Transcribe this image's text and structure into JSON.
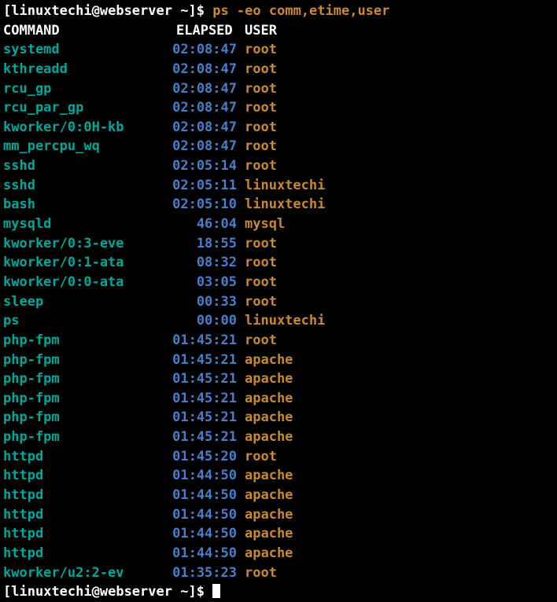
{
  "prompt": {
    "user": "linuxtechi",
    "host": "webserver",
    "path": "~",
    "command": "ps -eo comm,etime,user"
  },
  "headers": {
    "command": "COMMAND",
    "elapsed": "ELAPSED",
    "user": "USER"
  },
  "rows": [
    {
      "command": "systemd",
      "elapsed": "02:08:47",
      "user": "root"
    },
    {
      "command": "kthreadd",
      "elapsed": "02:08:47",
      "user": "root"
    },
    {
      "command": "rcu_gp",
      "elapsed": "02:08:47",
      "user": "root"
    },
    {
      "command": "rcu_par_gp",
      "elapsed": "02:08:47",
      "user": "root"
    },
    {
      "command": "kworker/0:0H-kb",
      "elapsed": "02:08:47",
      "user": "root"
    },
    {
      "command": "mm_percpu_wq",
      "elapsed": "02:08:47",
      "user": "root"
    },
    {
      "command": "sshd",
      "elapsed": "02:05:14",
      "user": "root"
    },
    {
      "command": "sshd",
      "elapsed": "02:05:11",
      "user": "linuxtechi"
    },
    {
      "command": "bash",
      "elapsed": "02:05:10",
      "user": "linuxtechi"
    },
    {
      "command": "mysqld",
      "elapsed": "46:04",
      "user": "mysql"
    },
    {
      "command": "kworker/0:3-eve",
      "elapsed": "18:55",
      "user": "root"
    },
    {
      "command": "kworker/0:1-ata",
      "elapsed": "08:32",
      "user": "root"
    },
    {
      "command": "kworker/0:0-ata",
      "elapsed": "03:05",
      "user": "root"
    },
    {
      "command": "sleep",
      "elapsed": "00:33",
      "user": "root"
    },
    {
      "command": "ps",
      "elapsed": "00:00",
      "user": "linuxtechi"
    },
    {
      "command": "php-fpm",
      "elapsed": "01:45:21",
      "user": "root"
    },
    {
      "command": "php-fpm",
      "elapsed": "01:45:21",
      "user": "apache"
    },
    {
      "command": "php-fpm",
      "elapsed": "01:45:21",
      "user": "apache"
    },
    {
      "command": "php-fpm",
      "elapsed": "01:45:21",
      "user": "apache"
    },
    {
      "command": "php-fpm",
      "elapsed": "01:45:21",
      "user": "apache"
    },
    {
      "command": "php-fpm",
      "elapsed": "01:45:21",
      "user": "apache"
    },
    {
      "command": "httpd",
      "elapsed": "01:45:20",
      "user": "root"
    },
    {
      "command": "httpd",
      "elapsed": "01:44:50",
      "user": "apache"
    },
    {
      "command": "httpd",
      "elapsed": "01:44:50",
      "user": "apache"
    },
    {
      "command": "httpd",
      "elapsed": "01:44:50",
      "user": "apache"
    },
    {
      "command": "httpd",
      "elapsed": "01:44:50",
      "user": "apache"
    },
    {
      "command": "httpd",
      "elapsed": "01:44:50",
      "user": "apache"
    },
    {
      "command": "kworker/u2:2-ev",
      "elapsed": "01:35:23",
      "user": "root"
    }
  ]
}
